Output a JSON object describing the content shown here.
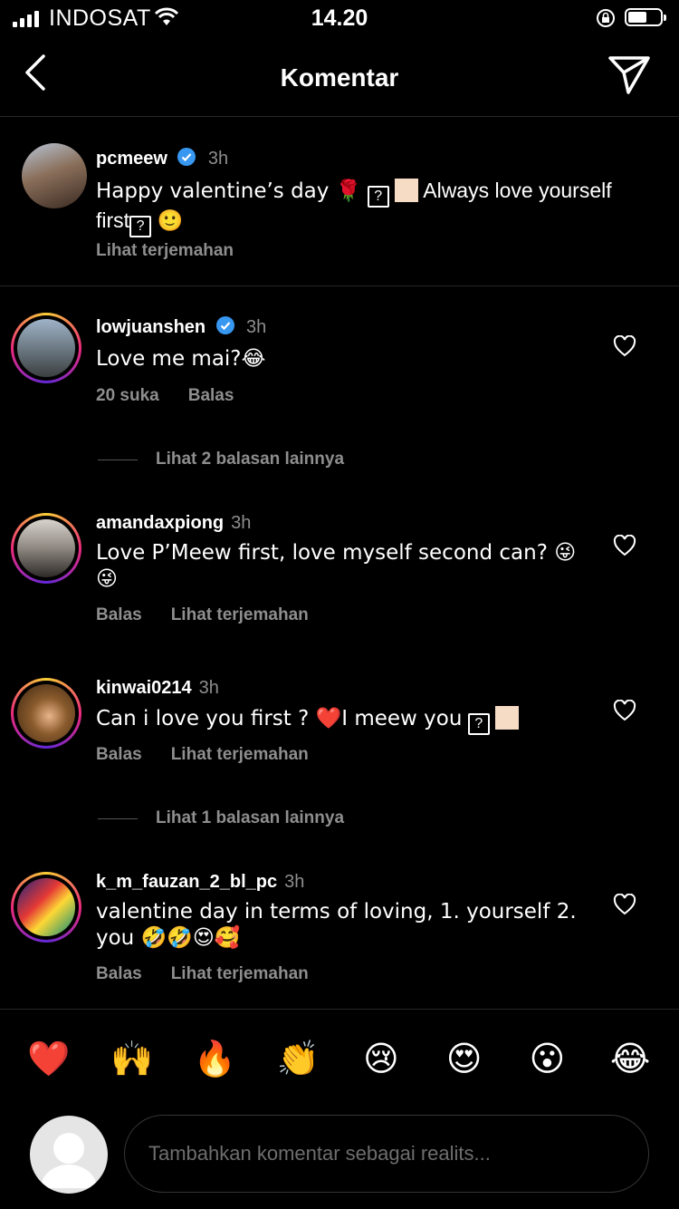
{
  "status_bar": {
    "carrier": "INDOSAT",
    "time": "14.20"
  },
  "header": {
    "title": "Komentar"
  },
  "caption": {
    "username": "pcmeew",
    "time": "3h",
    "text": "Happy valentine’s day 🌹",
    "text_after": " Always love yourself first",
    "emoji_end": "🙂",
    "translate": "Lihat terjemahan"
  },
  "comments": [
    {
      "username": "lowjuanshen",
      "time": "3h",
      "text": "Love me mai?😂",
      "likes": "20 suka",
      "reply": "Balas",
      "view_replies": "Lihat 2 balasan lainnya"
    },
    {
      "username": "amandaxpiong",
      "time": "3h",
      "text": "Love P’Meew first, love myself second can? 😜 😜",
      "reply": "Balas",
      "translate": "Lihat terjemahan"
    },
    {
      "username": "kinwai0214",
      "time": "3h",
      "text": "Can i love you first ? ❤️I meew you",
      "reply": "Balas",
      "translate": "Lihat terjemahan",
      "view_replies": "Lihat 1 balasan lainnya"
    },
    {
      "username": "k_m_fauzan_2_bl_pc",
      "time": "3h",
      "text": "valentine day in terms of loving, 1. yourself 2. you 🤣🤣😍🥰",
      "reply": "Balas",
      "translate": "Lihat terjemahan"
    }
  ],
  "reactions": [
    "❤️",
    "🙌",
    "🔥",
    "👏",
    "😢",
    "😍",
    "😮",
    "😂"
  ],
  "input": {
    "placeholder": "Tambahkan komentar sebagai realits..."
  },
  "icons": {
    "back": "chevron-left-icon",
    "send": "paper-plane-icon",
    "like": "heart-outline-icon",
    "verified": "verified-badge-icon"
  },
  "colors": {
    "background": "#000000",
    "secondary_text": "#8e8e8e",
    "verified_blue": "#3897f0",
    "divider": "#262626"
  }
}
